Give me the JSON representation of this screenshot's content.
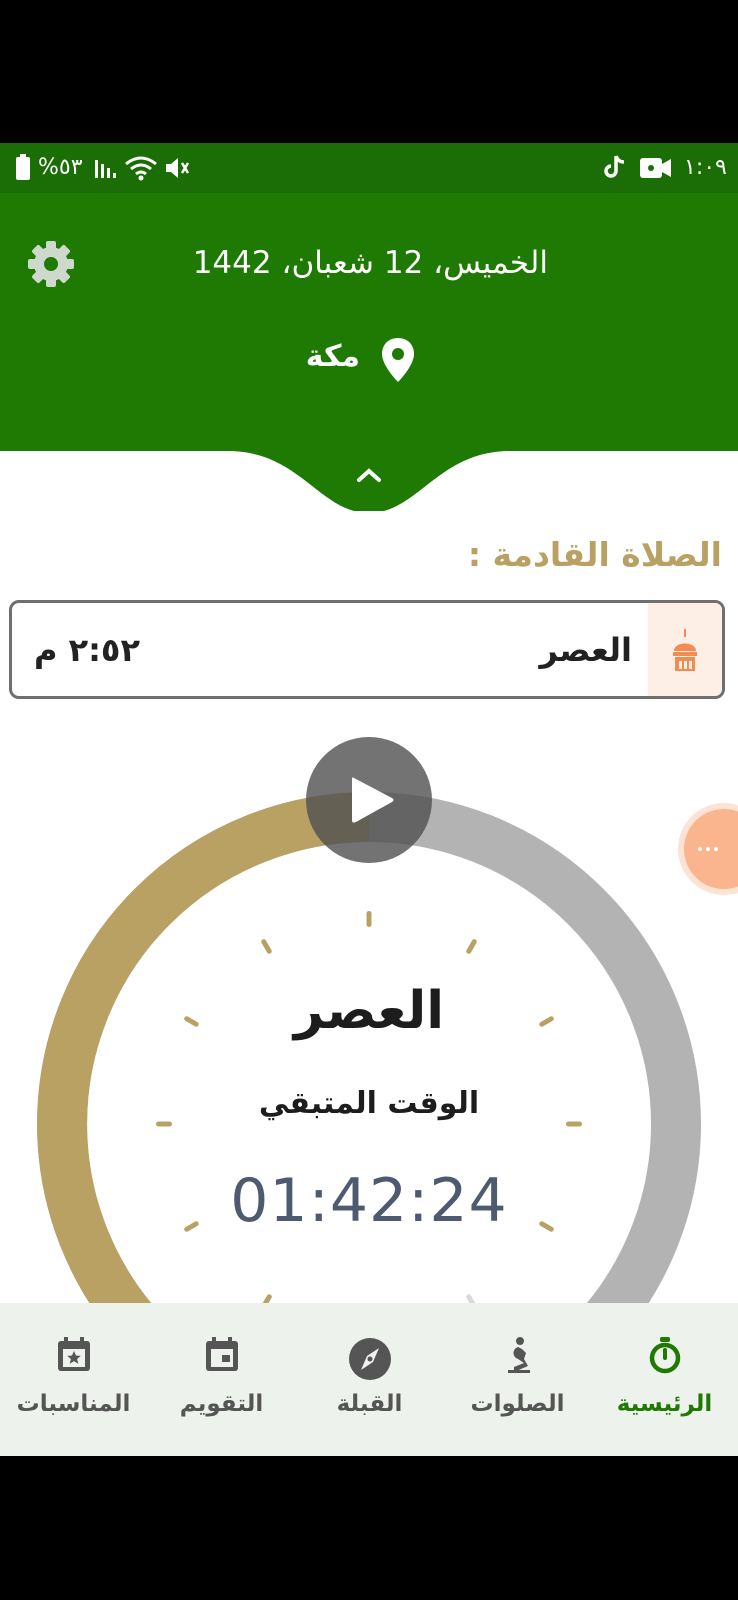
{
  "status_bar": {
    "time": "١:٠٩",
    "battery": "%٥٣"
  },
  "header": {
    "date": "الخميس، 12 شعبان، 1442",
    "city": "مكة"
  },
  "next_prayer": {
    "label": "الصلاة القادمة :",
    "name": "العصر",
    "time": "٢:٥٢ م"
  },
  "countdown_ring": {
    "prayer_name": "العصر",
    "remaining_label": "الوقت المتبقي",
    "remaining_time": "01:42:24",
    "progress_fraction": 0.5
  },
  "bottom_nav": {
    "items": [
      {
        "label": "الرئيسية",
        "icon": "stopwatch-icon",
        "active": true
      },
      {
        "label": "الصلوات",
        "icon": "prayer-person-icon",
        "active": false
      },
      {
        "label": "القبلة",
        "icon": "compass-icon",
        "active": false
      },
      {
        "label": "التقويم",
        "icon": "calendar-icon",
        "active": false
      },
      {
        "label": "المناسبات",
        "icon": "calendar-star-icon",
        "active": false
      }
    ]
  },
  "colors": {
    "header_green": "#1e7a02",
    "gold": "#b9a063",
    "ring_gray": "#b3b3b3"
  }
}
